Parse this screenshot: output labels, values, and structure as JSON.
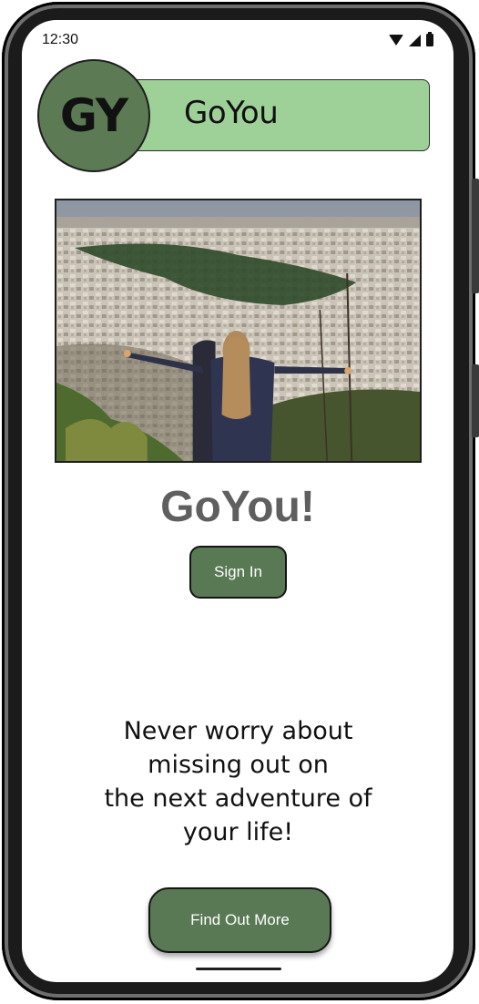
{
  "status_bar": {
    "time": "12:30",
    "icons": [
      "wifi-icon",
      "signal-icon",
      "battery-icon"
    ]
  },
  "header": {
    "logo_text": "GY",
    "title": "GoYou"
  },
  "hero": {
    "image": "woman-with-arms-outstretched-over-city-photo"
  },
  "main": {
    "app_title": "GoYou!",
    "sign_in_label": "Sign In",
    "tagline": "Never worry about\nmissing out on\nthe next  adventure of\nyour life!",
    "find_out_label": "Find Out More"
  },
  "colors": {
    "banner_bg": "#9ed197",
    "logo_bg": "#5c7b55",
    "button_bg": "#597954",
    "title_text": "#5f5f5f"
  }
}
